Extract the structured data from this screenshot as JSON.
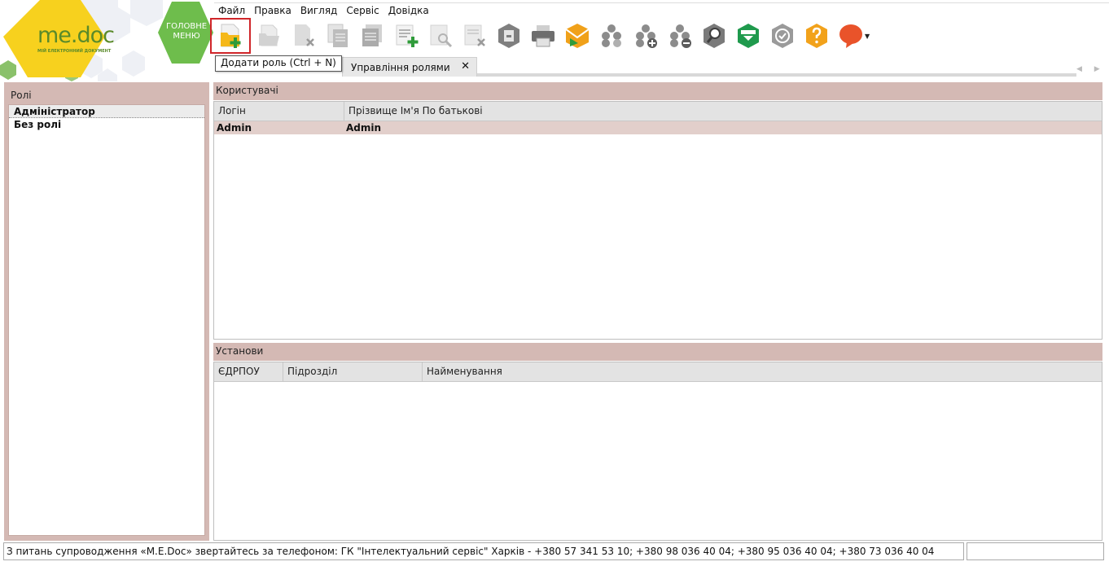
{
  "branding": {
    "logo_text": "me.doc",
    "logo_subtitle": "МІЙ ЕЛЕКТРОННИЙ ДОКУМЕНТ",
    "main_menu_label": "ГОЛОВНЕ МЕНЮ",
    "colors": {
      "logo_yellow": "#f7d11e",
      "main_menu_green": "#6ebd4c",
      "hex_light": "#eef0f5"
    }
  },
  "menubar": [
    "Файл",
    "Правка",
    "Вигляд",
    "Сервіс",
    "Довідка"
  ],
  "toolbar": {
    "buttons": [
      {
        "icon": "add-role-icon",
        "enabled": true,
        "highlighted": true
      },
      {
        "icon": "open-folder-icon",
        "enabled": false
      },
      {
        "icon": "delete-document-icon",
        "enabled": false
      },
      {
        "icon": "copy-document-icon",
        "enabled": false
      },
      {
        "icon": "document-list-icon",
        "enabled": false
      },
      {
        "icon": "add-list-item-icon",
        "enabled": true
      },
      {
        "icon": "view-document-icon",
        "enabled": false
      },
      {
        "icon": "remove-document-icon",
        "enabled": false
      },
      {
        "icon": "archive-icon",
        "enabled": true
      },
      {
        "icon": "printer-icon",
        "enabled": true
      },
      {
        "icon": "send-mail-icon",
        "enabled": true
      },
      {
        "icon": "group-settings-icon",
        "enabled": true
      },
      {
        "icon": "group-add-icon",
        "enabled": true
      },
      {
        "icon": "group-remove-icon",
        "enabled": true
      },
      {
        "icon": "search-icon",
        "enabled": true
      },
      {
        "icon": "filter-icon",
        "enabled": true
      },
      {
        "icon": "verify-icon",
        "enabled": true
      },
      {
        "icon": "help-icon",
        "enabled": true
      },
      {
        "icon": "chat-icon",
        "enabled": true
      }
    ],
    "tooltip": "Додати роль (Ctrl + N)"
  },
  "tab": {
    "label": "Управління ролями"
  },
  "roles_panel": {
    "title": "Ролі",
    "items": [
      "Адміністратор",
      "Без ролі"
    ],
    "selected_index": 0
  },
  "users_panel": {
    "title": "Користувачі",
    "columns": [
      "Логін",
      "Прізвище Ім'я По батькові"
    ],
    "rows": [
      [
        "Admin",
        "Admin"
      ]
    ]
  },
  "institutions_panel": {
    "title": "Установи",
    "columns": [
      "ЄДРПОУ",
      "Підрозділ",
      "Найменування"
    ],
    "rows": []
  },
  "statusbar": {
    "text": "З питань супроводження «M.E.Doc» звертайтесь за телефоном: ГК \"Інтелектуальний сервіс\" Харків - +380 57 341 53 10; +380 98 036 40 04; +380 95 036 40 04; +380 73 036 40 04"
  }
}
